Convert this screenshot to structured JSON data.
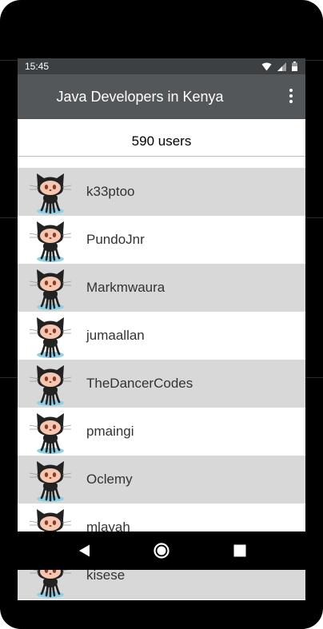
{
  "status_bar": {
    "time": "15:45"
  },
  "toolbar": {
    "title": "Java Developers in Kenya"
  },
  "summary": {
    "count_text": "590 users"
  },
  "users": [
    {
      "username": "k33ptoo"
    },
    {
      "username": "PundoJnr"
    },
    {
      "username": "Markmwaura"
    },
    {
      "username": "jumaallan"
    },
    {
      "username": "TheDancerCodes"
    },
    {
      "username": "pmaingi"
    },
    {
      "username": "Oclemy"
    },
    {
      "username": "mlayah"
    },
    {
      "username": "kisese"
    }
  ],
  "icons": {
    "avatar": "octocat-avatar-icon",
    "wifi": "wifi-icon",
    "signal": "cell-signal-icon",
    "battery": "battery-icon",
    "overflow": "overflow-menu-icon",
    "back": "back-icon",
    "home": "home-icon",
    "recents": "recents-icon"
  },
  "colors": {
    "toolbar": "#535759",
    "status_bar": "#3c4043",
    "row_shaded": "#d8d8d8",
    "row_plain": "#ffffff"
  }
}
